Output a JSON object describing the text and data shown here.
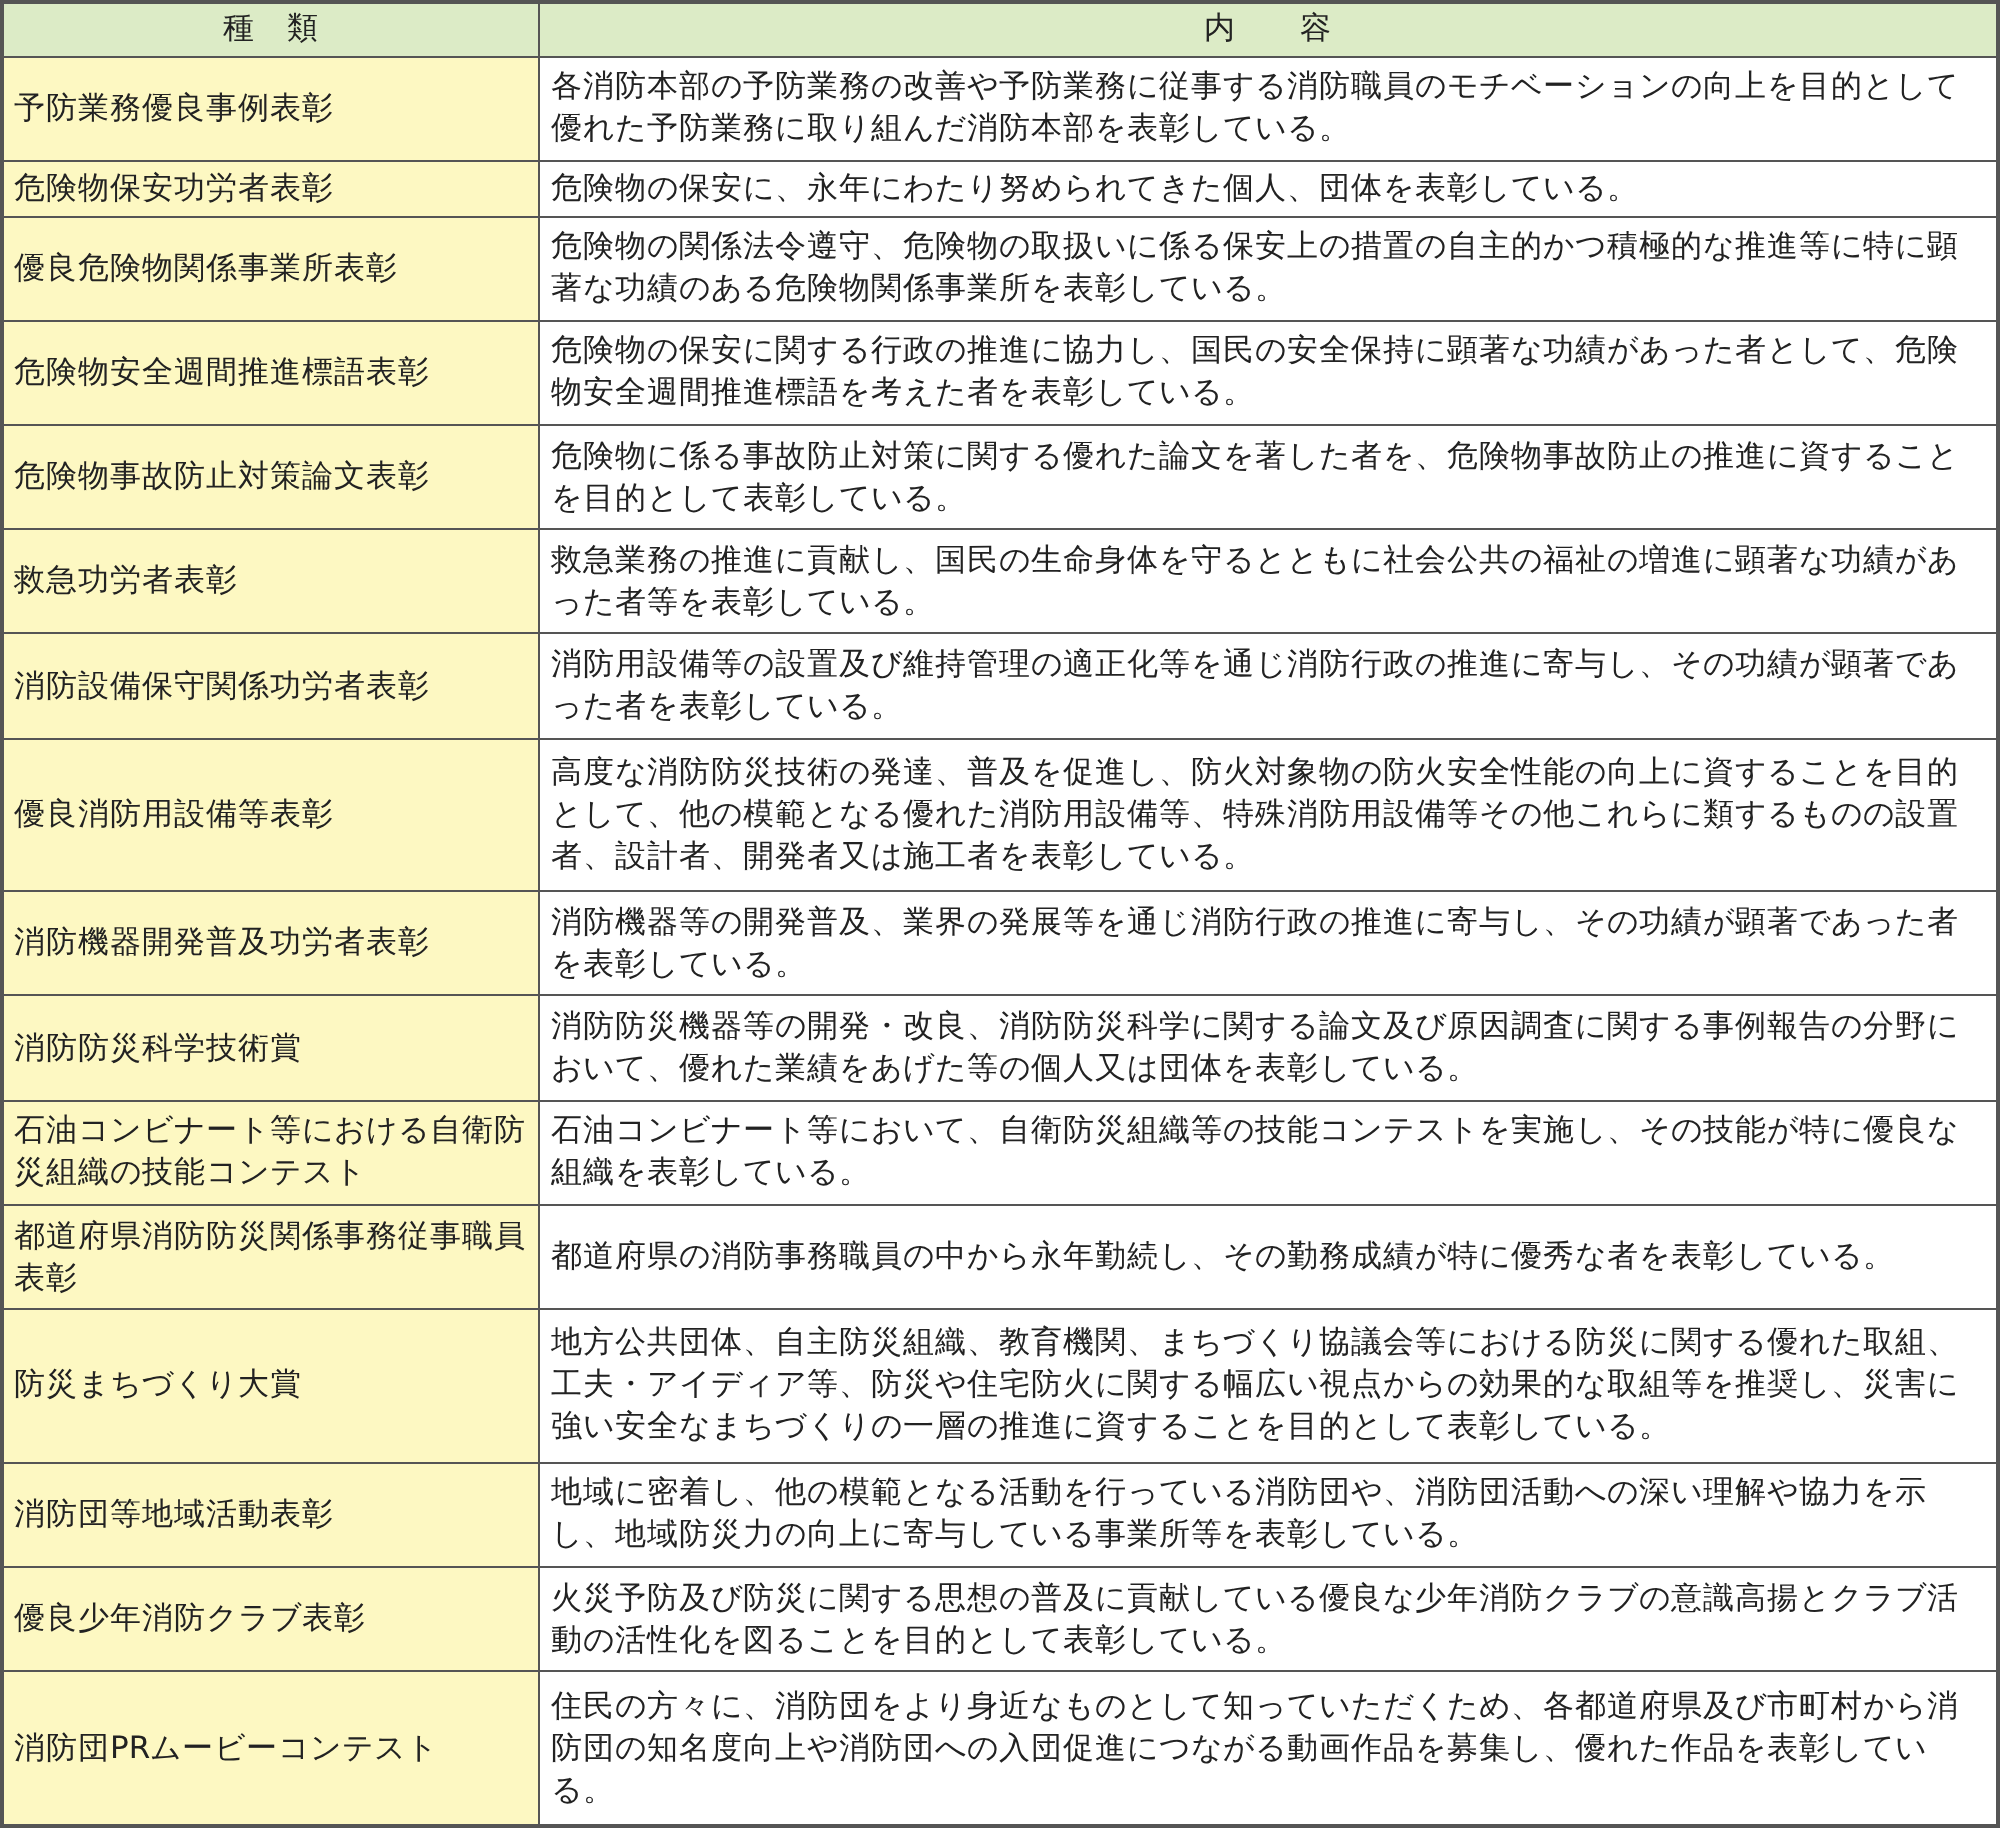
{
  "table": {
    "columns": [
      "種　類",
      "内　　容"
    ],
    "rows": [
      {
        "type": "予防業務優良事例表彰",
        "content": "各消防本部の予防業務の改善や予防業務に従事する消防職員のモチベーションの向上を目的として優れた予防業務に取り組んだ消防本部を表彰している。"
      },
      {
        "type": "危険物保安功労者表彰",
        "content": "危険物の保安に、永年にわたり努められてきた個人、団体を表彰している。"
      },
      {
        "type": "優良危険物関係事業所表彰",
        "content": "危険物の関係法令遵守、危険物の取扱いに係る保安上の措置の自主的かつ積極的な推進等に特に顕著な功績のある危険物関係事業所を表彰している。"
      },
      {
        "type": "危険物安全週間推進標語表彰",
        "content": "危険物の保安に関する行政の推進に協力し、国民の安全保持に顕著な功績があった者として、危険物安全週間推進標語を考えた者を表彰している。"
      },
      {
        "type": "危険物事故防止対策論文表彰",
        "content": "危険物に係る事故防止対策に関する優れた論文を著した者を、危険物事故防止の推進に資することを目的として表彰している。"
      },
      {
        "type": "救急功労者表彰",
        "content": "救急業務の推進に貢献し、国民の生命身体を守るとともに社会公共の福祉の増進に顕著な功績があった者等を表彰している。"
      },
      {
        "type": "消防設備保守関係功労者表彰",
        "content": "消防用設備等の設置及び維持管理の適正化等を通じ消防行政の推進に寄与し、その功績が顕著であった者を表彰している。"
      },
      {
        "type": "優良消防用設備等表彰",
        "content": "高度な消防防災技術の発達、普及を促進し、防火対象物の防火安全性能の向上に資することを目的として、他の模範となる優れた消防用設備等、特殊消防用設備等その他これらに類するものの設置者、設計者、開発者又は施工者を表彰している。"
      },
      {
        "type": "消防機器開発普及功労者表彰",
        "content": "消防機器等の開発普及、業界の発展等を通じ消防行政の推進に寄与し、その功績が顕著であった者を表彰している。"
      },
      {
        "type": "消防防災科学技術賞",
        "content": "消防防災機器等の開発・改良、消防防災科学に関する論文及び原因調査に関する事例報告の分野において、優れた業績をあげた等の個人又は団体を表彰している。"
      },
      {
        "type": "石油コンビナート等における自衛防災組織の技能コンテスト",
        "content": "石油コンビナート等において、自衛防災組織等の技能コンテストを実施し、その技能が特に優良な組織を表彰している。"
      },
      {
        "type": "都道府県消防防災関係事務従事職員表彰",
        "content": "都道府県の消防事務職員の中から永年勤続し、その勤務成績が特に優秀な者を表彰している。"
      },
      {
        "type": "防災まちづくり大賞",
        "content": "地方公共団体、自主防災組織、教育機関、まちづくり協議会等における防災に関する優れた取組、工夫・アイディア等、防災や住宅防火に関する幅広い視点からの効果的な取組等を推奨し、災害に強い安全なまちづくりの一層の推進に資することを目的として表彰している。"
      },
      {
        "type": "消防団等地域活動表彰",
        "content": "地域に密着し、他の模範となる活動を行っている消防団や、消防団活動への深い理解や協力を示し、地域防災力の向上に寄与している事業所等を表彰している。"
      },
      {
        "type": "優良少年消防クラブ表彰",
        "content": "火災予防及び防災に関する思想の普及に貢献している優良な少年消防クラブの意識高揚とクラブ活動の活性化を図ることを目的として表彰している。"
      },
      {
        "type": "消防団PRムービーコンテスト",
        "content": "住民の方々に、消防団をより身近なものとして知っていただくため、各都道府県及び市町村から消防団の知名度向上や消防団への入団促進につながる動画作品を募集し、優れた作品を表彰している。"
      }
    ]
  }
}
